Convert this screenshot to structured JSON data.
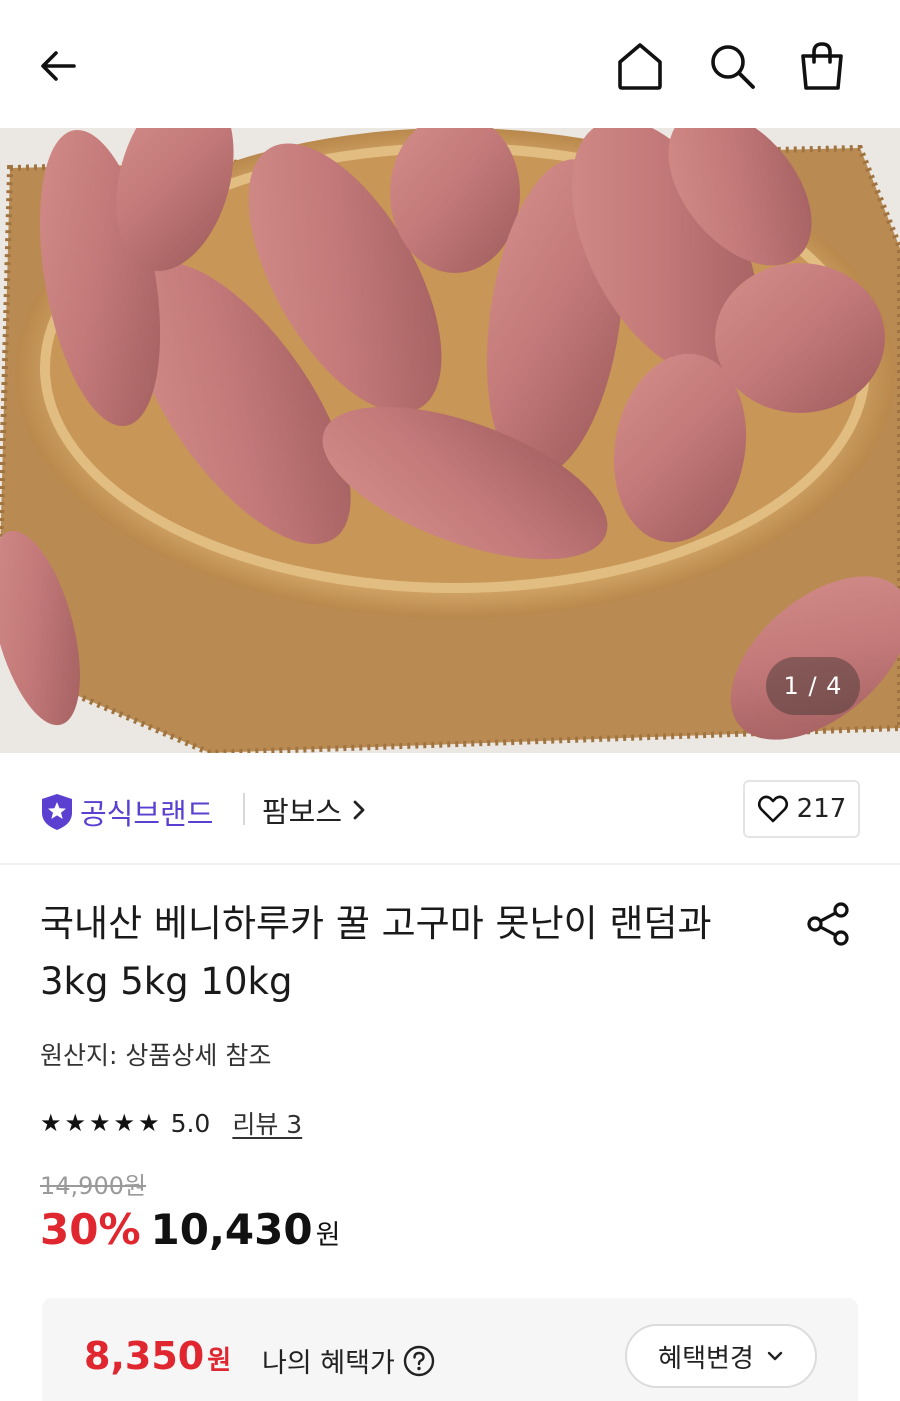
{
  "gallery": {
    "current": 1,
    "total": 4,
    "counter_text": "1 / 4"
  },
  "brand": {
    "official_label": "공식브랜드",
    "seller_name": "팜보스",
    "like_count": "217"
  },
  "product": {
    "title_line1": "국내산 베니하루카 꿀 고구마 못난이 랜덤과",
    "title_line2": "3kg 5kg 10kg",
    "origin": "원산지: 상품상세 참조",
    "rating": {
      "stars": 5,
      "score": "5.0",
      "review_text": "리뷰 3"
    },
    "original_price": "14,900원",
    "discount": "30%",
    "price": "10,430",
    "currency": "원"
  },
  "benefit": {
    "price": "8,350",
    "currency": "원",
    "label": "나의 혜택가",
    "change_button": "혜택변경"
  },
  "icons": {
    "back": "arrow-left-icon",
    "home": "home-icon",
    "search": "search-icon",
    "cart": "shopping-bag-icon",
    "share": "share-icon",
    "heart": "heart-icon",
    "official": "shield-star-icon",
    "help": "question-circle-icon"
  },
  "colors": {
    "accent_red": "#e0262f",
    "brand_purple": "#5a3fd1"
  }
}
